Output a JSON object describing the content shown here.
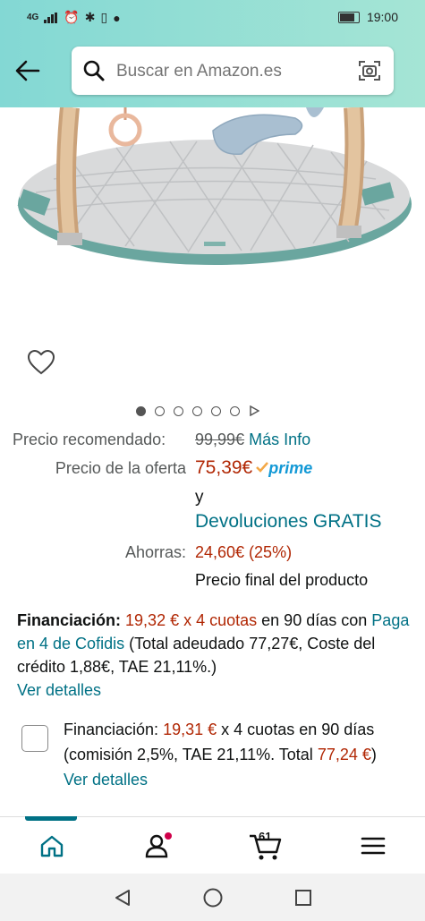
{
  "status_bar": {
    "network": "4G",
    "time": "19:00"
  },
  "search": {
    "placeholder": "Buscar en Amazon.es"
  },
  "carousel": {
    "total_dots": 6,
    "active_index": 0
  },
  "price": {
    "recommended_label": "Precio recomendado:",
    "recommended_value": "99,99€",
    "more_info_link": "Más Info",
    "offer_label": "Precio de la oferta",
    "offer_value": "75,39€",
    "prime_label": "prime",
    "and_text": "y",
    "returns_link": "Devoluciones GRATIS",
    "savings_label": "Ahorras:",
    "savings_value": "24,60€ (25%)",
    "final_price_note": "Precio final del producto"
  },
  "financing": {
    "title": "Financiación:",
    "amount": "19,32 € x 4 cuotas",
    "period": "en 90 días",
    "with_text": "con",
    "provider_link": "Paga en 4 de Cofidis",
    "details_text": "(Total adeudado 77,27€, Coste del crédito 1,88€, TAE 21,11%.)",
    "details_link": "Ver detalles"
  },
  "financing_option": {
    "prefix": "Financiación:",
    "amount": "19,31 €",
    "text_1": "x 4 cuotas en 90 días (comisión 2,5%, TAE 21,11%. Total",
    "total": "77,24 €",
    "closing": ")",
    "details_link": "Ver detalles",
    "checked": false
  },
  "bottom_nav": {
    "cart_count": "61",
    "items": [
      "home-icon",
      "account-icon",
      "cart-icon",
      "menu-icon"
    ]
  },
  "colors": {
    "header_start": "#83d8d4",
    "header_end": "#a5e5d5",
    "price_red": "#b12704",
    "link_teal": "#007185",
    "prime_blue": "#1399d6",
    "prime_check": "#f3a847"
  }
}
